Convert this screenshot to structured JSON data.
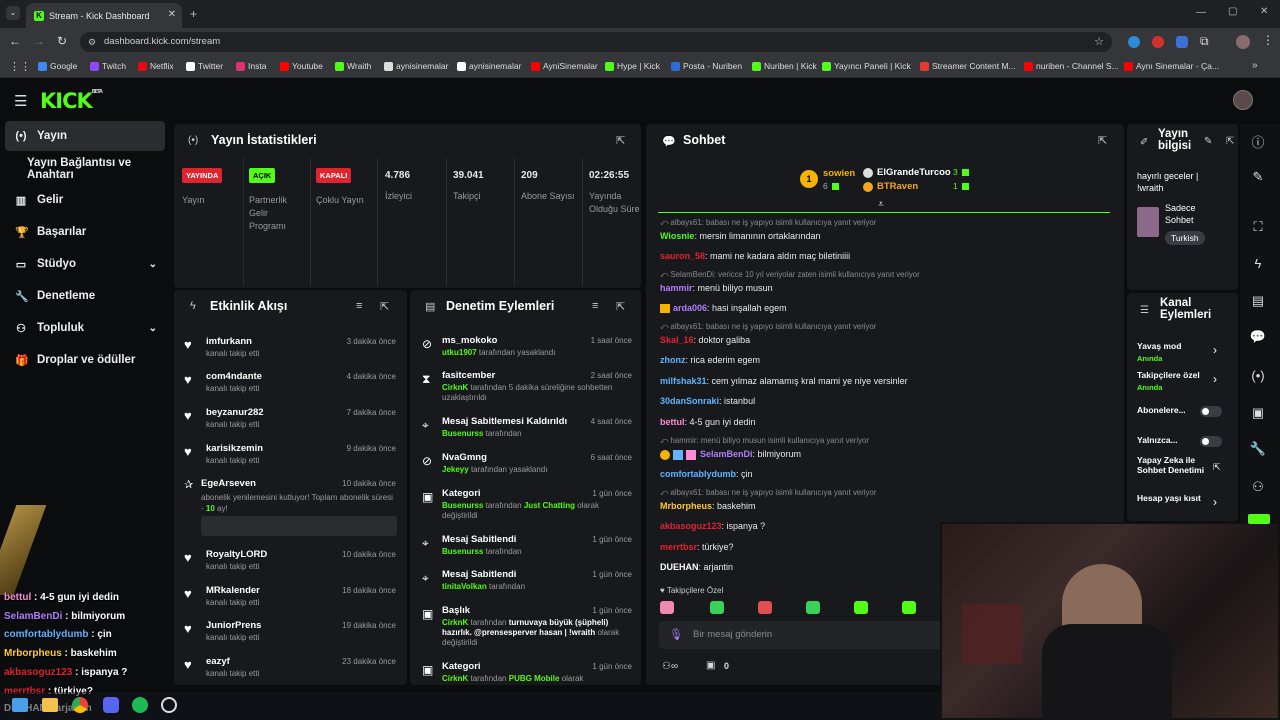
{
  "browser": {
    "tab_title": "Stream - Kick Dashboard",
    "url": "dashboard.kick.com/stream",
    "bookmarks": [
      {
        "label": "Google",
        "color": "#4285f4"
      },
      {
        "label": "Twitch",
        "color": "#9146ff"
      },
      {
        "label": "Netflix",
        "color": "#e50914"
      },
      {
        "label": "Twitter",
        "color": "#ffffff"
      },
      {
        "label": "Insta",
        "color": "#e1306c"
      },
      {
        "label": "Youtube",
        "color": "#ff0000"
      },
      {
        "label": "Wraith",
        "color": "#53fc18"
      },
      {
        "label": "aynisinemalar",
        "color": "#dddddd"
      },
      {
        "label": "aynisinemalar",
        "color": "#ffffff"
      },
      {
        "label": "AyniSinemalar",
        "color": "#ff0000"
      },
      {
        "label": "Hype | Kick",
        "color": "#53fc18"
      },
      {
        "label": "Posta - Nuriben",
        "color": "#2b6cd9"
      },
      {
        "label": "Nuriben | Kick",
        "color": "#53fc18"
      },
      {
        "label": "Yayıncı Paneli | Kick",
        "color": "#53fc18"
      },
      {
        "label": "Streamer Content M...",
        "color": "#e53935"
      },
      {
        "label": "nuriben - Channel S...",
        "color": "#ff0000"
      },
      {
        "label": "Aynı Sinemalar - Ça...",
        "color": "#ff0000"
      }
    ]
  },
  "app": {
    "logo": "KICK",
    "logo_badge": "BETA"
  },
  "sidebar": {
    "items": [
      {
        "label": "Yayın",
        "icon": "stream-icon"
      },
      {
        "label": "Yayın Bağlantısı ve Anahtarı",
        "icon": ""
      },
      {
        "label": "Gelir",
        "icon": "chart-icon"
      },
      {
        "label": "Başarılar",
        "icon": "trophy-icon"
      },
      {
        "label": "Stüdyo",
        "icon": "studio-icon"
      },
      {
        "label": "Denetleme",
        "icon": "wrench-icon"
      },
      {
        "label": "Topluluk",
        "icon": "community-icon"
      },
      {
        "label": "Droplar ve ödüller",
        "icon": "gift-icon"
      }
    ]
  },
  "stats": {
    "title": "Yayın İstatistikleri",
    "badges": [
      {
        "badge": "YAYINDA",
        "label": "Yayın",
        "bg": "#e0242f",
        "fg": "#ffffff"
      },
      {
        "badge": "AÇIK",
        "label": "Partnerlik Gelir Programı",
        "bg": "#53fc18",
        "fg": "#000000"
      },
      {
        "badge": "KAPALI",
        "label": "Çoklu Yayın",
        "bg": "#e0242f",
        "fg": "#ffffff"
      }
    ],
    "values": [
      {
        "value": "4.786",
        "label": "İzleyici"
      },
      {
        "value": "39.041",
        "label": "Takipçi"
      },
      {
        "value": "209",
        "label": "Abone Sayısı"
      },
      {
        "value": "02:26:55",
        "label": "Yayında Olduğu Süre"
      }
    ]
  },
  "activity": {
    "title": "Etkinlik Akışı",
    "items": [
      {
        "name": "imfurkann",
        "sub": "kanalı takip etti",
        "time": "3 dakika önce"
      },
      {
        "name": "com4ndante",
        "sub": "kanalı takip etti",
        "time": "4 dakika önce"
      },
      {
        "name": "beyzanur282",
        "sub": "kanalı takip etti",
        "time": "7 dakika önce"
      },
      {
        "name": "karisikzemin",
        "sub": "kanalı takip etti",
        "time": "9 dakika önce"
      }
    ],
    "sub_event": {
      "name": "EgeArseven",
      "sub": "abonelik yenilemesini kutluyor! Toplam abonelik süresi -",
      "months": "10",
      "suffix": "ay!",
      "time": "10 dakika önce"
    },
    "items2": [
      {
        "name": "RoyaltyLORD",
        "sub": "kanalı takip etti",
        "time": "10 dakika önce"
      },
      {
        "name": "MRkalender",
        "sub": "kanalı takip etti",
        "time": "18 dakika önce"
      },
      {
        "name": "JuniorPrens",
        "sub": "kanalı takip etti",
        "time": "19 dakika önce"
      },
      {
        "name": "eazyf",
        "sub": "kanalı takip etti",
        "time": "23 dakika önce"
      }
    ]
  },
  "moderation": {
    "title": "Denetim Eylemleri",
    "items": [
      {
        "title": "ms_mokoko",
        "actor": "utku1907",
        "text": "tarafından yasaklandı",
        "time": "1 saat önce"
      },
      {
        "title": "fasitcember",
        "actor": "CirknK",
        "text": "tarafından 5 dakika süreliğine sohbetten uzaklaştırıldı",
        "time": "2 saat önce"
      },
      {
        "title": "Mesaj Sabitlemesi Kaldırıldı",
        "actor": "Busenurss",
        "text": "tarafından",
        "time": "4 saat önce"
      },
      {
        "title": "NvaGmng",
        "actor": "Jekeyy",
        "text": "tarafından yasaklandı",
        "time": "6 saat önce"
      },
      {
        "title": "Kategori",
        "actor": "Busenurss",
        "text": "tarafından",
        "extra": "Just Chatting",
        "extra2": "olarak değiştirildi",
        "time": "1 gün önce"
      },
      {
        "title": "Mesaj Sabitlendi",
        "actor": "Busenurss",
        "text": "tarafından",
        "time": "1 gün önce"
      },
      {
        "title": "Mesaj Sabitlendi",
        "actor": "tinitaVolkan",
        "text": "tarafından",
        "time": "1 gün önce"
      },
      {
        "title": "Başlık",
        "actor": "CirknK",
        "text": "tarafından",
        "extra": "turnuvaya büyük (şüpheli) hazırlık. @prensesperver hasan | !wraith",
        "extra2": "olarak değiştirildi",
        "time": "1 gün önce"
      },
      {
        "title": "Kategori",
        "actor": "CirknK",
        "text": "tarafından",
        "extra": "PUBG Mobile",
        "extra2": "olarak",
        "time": "1 gün önce"
      }
    ]
  },
  "chat": {
    "title": "Sohbet",
    "leaders": [
      {
        "name": "sowien",
        "count": "6"
      },
      {
        "name": "ElGrandeTurcoo",
        "count": "3"
      },
      {
        "name": "BTRaven",
        "count": "1"
      }
    ],
    "lines": [
      {
        "reply": "albayx61: babası ne iş yapıyo isimli kullanıcıya yanıt veriyor"
      },
      {
        "user": "Wiosnie",
        "color": "#53fc18",
        "msg": "mersin limanının ortaklarından"
      },
      {
        "user": "sauron_58",
        "color": "#e0242f",
        "msg": "mami ne kadara aldın maç biletiniiii"
      },
      {
        "reply": "SelamBenDi: vericce 10 yıl veriyolar zaten isimli kullanıcıya yanıt veriyor"
      },
      {
        "user": "hammir",
        "color": "#b47cff",
        "msg": "menü biliyo musun"
      },
      {
        "user": "arda006",
        "color": "#b47cff",
        "msg": "hasi inşallah egem"
      },
      {
        "reply": "albayx61: babası ne iş yapıyo isimli kullanıcıya yanıt veriyor"
      },
      {
        "user": "Skal_16",
        "color": "#e0242f",
        "msg": "doktor galiba"
      },
      {
        "user": "zhonz",
        "color": "#5fb3ff",
        "msg": "rica ederim egem"
      },
      {
        "user": "milfshak31",
        "color": "#5fb3ff",
        "msg": "cem yılmaz alamamış kral mami ye niye versinler"
      },
      {
        "user": "30danSonraki",
        "color": "#5fb3ff",
        "msg": "istanbul"
      },
      {
        "user": "bettul",
        "color": "#ff8ad8",
        "msg": "4-5 gun iyi dedin"
      },
      {
        "reply": "hammir: menü biliyo musun isimli kullanıcıya yanıt veriyor"
      },
      {
        "user": "SelamBenDi",
        "color": "#b47cff",
        "msg": "bilmiyorum"
      },
      {
        "user": "comfortablydumb",
        "color": "#5fb3ff",
        "msg": "çin"
      },
      {
        "reply": "albayx61: babası ne iş yapıyo isimli kullanıcıya yanıt veriyor"
      },
      {
        "user": "Mrborpheus",
        "color": "#ffcc33",
        "msg": "baskehim"
      },
      {
        "user": "akbasoguz123",
        "color": "#e0242f",
        "msg": "ispanya ?"
      },
      {
        "user": "merrtbsr",
        "color": "#e0242f",
        "msg": "türkiye?"
      },
      {
        "user": "DUEHAN",
        "color": "#ffffff",
        "msg": "arjantin"
      }
    ],
    "followers_only": "Takipçilere Özel",
    "input_placeholder": "Bir mesaj gönderin",
    "points": "0"
  },
  "stream_info": {
    "title": "Yayın bilgisi",
    "stream_title": "hayırlı geceler | !wraith",
    "category": "Sadece Sohbet",
    "language": "Turkish"
  },
  "channel_actions": {
    "title": "Kanal Eylemleri",
    "items": [
      {
        "label": "Yavaş mod",
        "state": "Anında"
      },
      {
        "label": "Takipçilere özel",
        "state": "Anında"
      },
      {
        "label": "Abonelere...",
        "state": ""
      },
      {
        "label": "Yalnızca...",
        "state": ""
      },
      {
        "label": "Yapay Zeka ile Sohbet Denetimi",
        "state": ""
      },
      {
        "label": "Hesap yaşı kısıt",
        "state": ""
      }
    ]
  },
  "overlay_chat": [
    {
      "user": "bettul",
      "msg": "4-5 gun iyi dedin",
      "color": "#ff8ad8"
    },
    {
      "user": "SelamBenDi",
      "msg": "bilmiyorum",
      "color": "#b47cff"
    },
    {
      "user": "comfortablydumb",
      "msg": "çin",
      "color": "#5fb3ff"
    },
    {
      "user": "Mrborpheus",
      "msg": "baskehim",
      "color": "#ffcc33"
    },
    {
      "user": "akbasoguz123",
      "msg": "ispanya ?",
      "color": "#e0242f"
    },
    {
      "user": "merrtbsr",
      "msg": "türkiye?",
      "color": "#e0242f"
    },
    {
      "user": "DUEHAN",
      "msg": "arjantin",
      "color": "#ffffff"
    }
  ]
}
